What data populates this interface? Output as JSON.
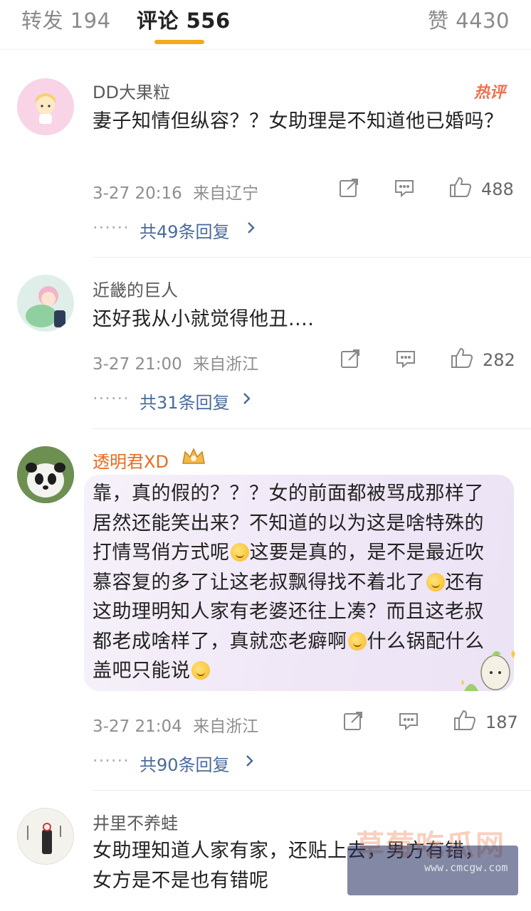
{
  "tabs": {
    "repost": "转发 194",
    "comments": "评论 556",
    "likes": "赞 4430"
  },
  "colors": {
    "accent": "#f4a91a",
    "link": "#4a6a99",
    "vip_name": "#e86b1e",
    "hot_badge": "#f07050"
  },
  "comments": [
    {
      "user": "DD大果粒",
      "hot_badge": "热评",
      "text": "妻子知情但纵容？？女助理是不知道他已婚吗？",
      "time": "3-27 20:16",
      "location": "来自辽宁",
      "likes": "488",
      "replies_dots": "······",
      "replies": "共49条回复"
    },
    {
      "user": "近畿的巨人",
      "text": "还好我从小就觉得他丑....",
      "time": "3-27 21:00",
      "location": "来自浙江",
      "likes": "282",
      "replies_dots": "······",
      "replies": "共31条回复"
    },
    {
      "user": "透明君XD",
      "text_parts": [
        "靠，真的假的？？？女的前面都被骂成那样了居然还能笑出来？不知道的以为这是啥特殊的打情骂俏方式呢",
        "这要是真的，是不是最近吹慕容复的多了让这老叔飘得找不着北了",
        "还有这助理明知人家有老婆还往上凑？而且这老叔都老成啥样了，真就恋老癖啊",
        "什么锅配什么盖吧只能说"
      ],
      "time": "3-27 21:04",
      "location": "来自浙江",
      "likes": "187",
      "replies_dots": "······",
      "replies": "共90条回复"
    },
    {
      "user": "井里不养蛙",
      "text": "女助理知道人家有家，还贴上去，男方有错，女方是不是也有错呢"
    }
  ],
  "watermark": {
    "text": "草莓吃瓜网",
    "site": "www.cmcgw.com"
  }
}
